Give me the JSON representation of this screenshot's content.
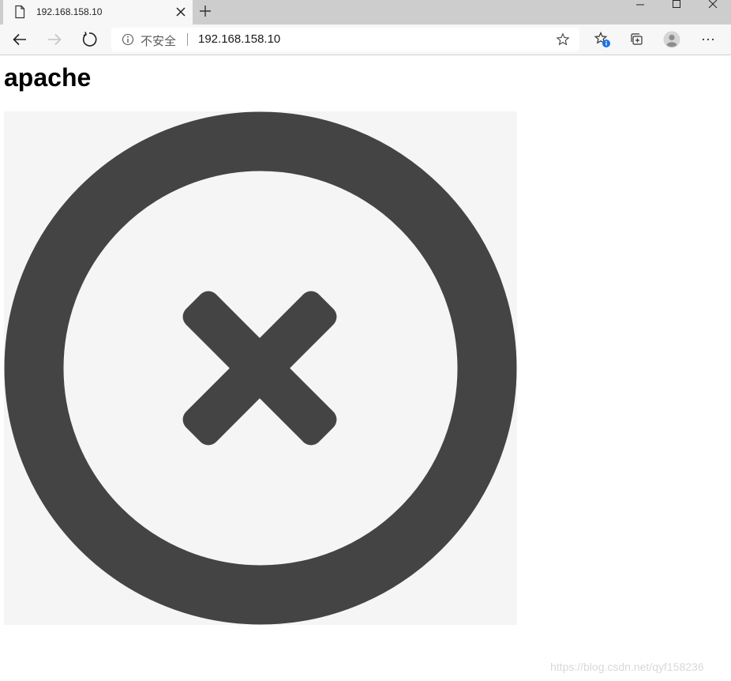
{
  "browser": {
    "tab": {
      "title": "192.168.158.10",
      "icon": "page-icon"
    },
    "address_bar": {
      "security_label": "不安全",
      "url": "192.168.158.10"
    }
  },
  "page": {
    "heading": "apache",
    "image": {
      "state": "broken",
      "icon": "close-circle-icon"
    }
  },
  "watermark": "https://blog.csdn.net/qyf158236",
  "colors": {
    "tabstrip": "#cdcdcd",
    "toolbar": "#f7f7f7",
    "icon_dark": "#444444",
    "image_background": "#f5f5f5",
    "badge_blue": "#1a73e8"
  }
}
